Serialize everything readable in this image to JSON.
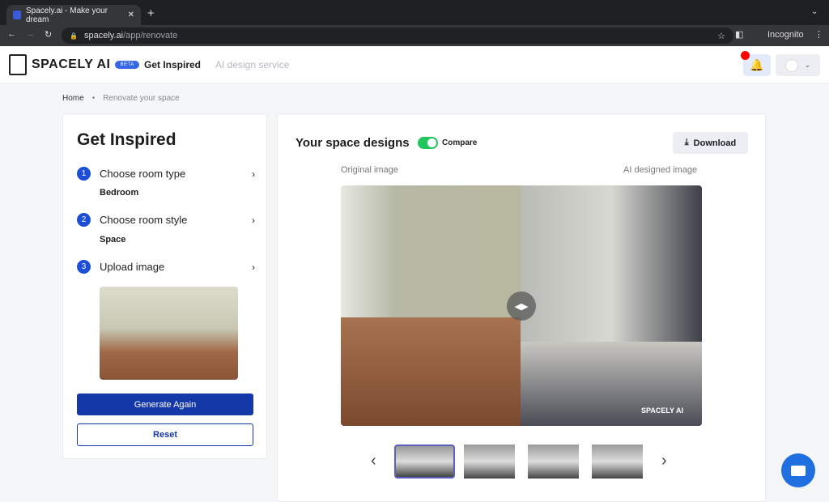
{
  "browser": {
    "tab_title": "Spacely.ai - Make your dream",
    "url_host": "spacely.ai",
    "url_path": "/app/renovate",
    "profile": "Incognito"
  },
  "header": {
    "logo": "SPACELY AI",
    "beta": "BETA",
    "nav": [
      "Get Inspired",
      "AI design service"
    ]
  },
  "breadcrumb": [
    "Home",
    "Renovate your space"
  ],
  "left": {
    "title": "Get Inspired",
    "steps": [
      {
        "num": "1",
        "label": "Choose room type",
        "value": "Bedroom"
      },
      {
        "num": "2",
        "label": "Choose room style",
        "value": "Space"
      },
      {
        "num": "3",
        "label": "Upload image"
      }
    ],
    "generate": "Generate Again",
    "reset": "Reset"
  },
  "right": {
    "title": "Your space designs",
    "compare": "Compare",
    "compare_on": true,
    "download": "Download",
    "original_label": "Original image",
    "ai_label": "AI designed image",
    "watermark": "SPACELY AI"
  },
  "colors": {
    "primary": "#1538a8",
    "toggle": "#22c55e",
    "notification": "#ff0000"
  }
}
